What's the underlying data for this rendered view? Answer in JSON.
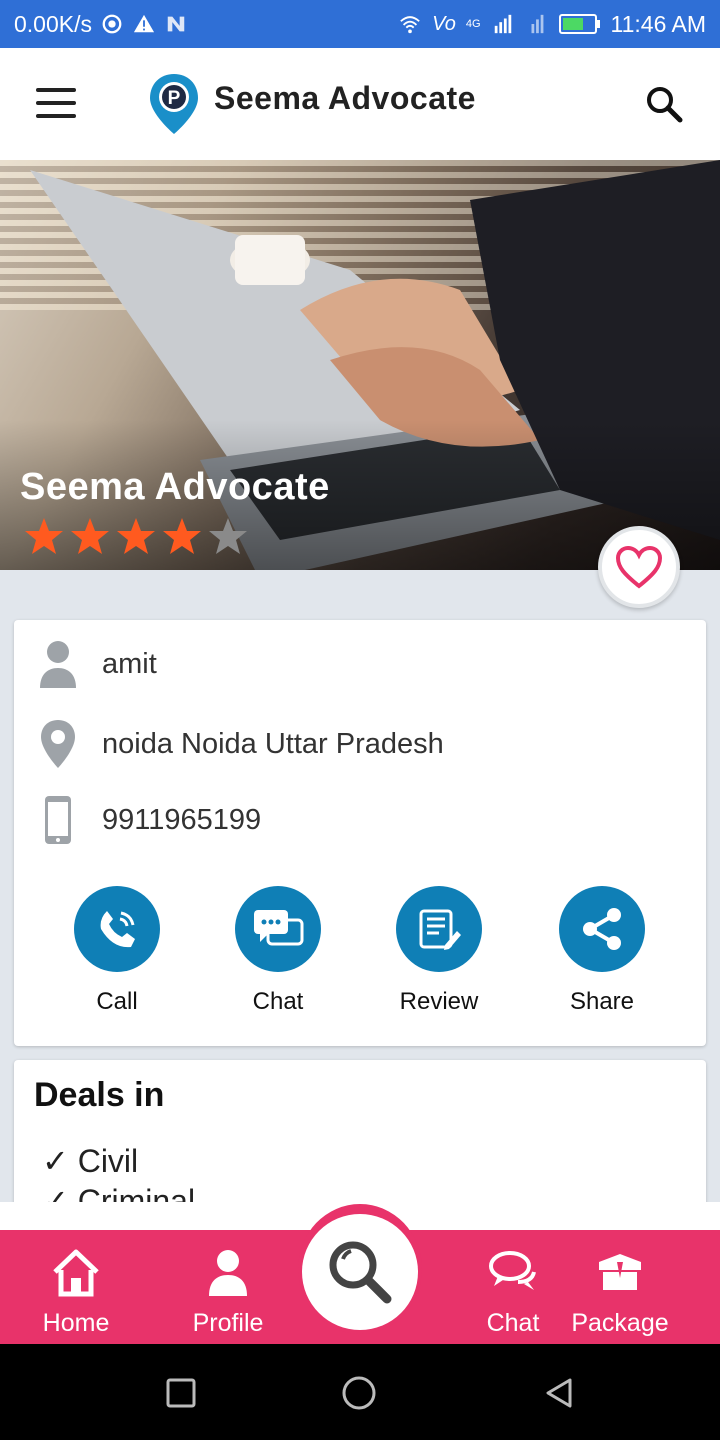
{
  "status_bar": {
    "speed": "0.00K/s",
    "time": "11:46 AM",
    "volte_label": "Vo",
    "network_label": "4G"
  },
  "app_bar": {
    "title": "Seema Advocate",
    "logo_letter": "P"
  },
  "hero": {
    "name": "Seema Advocate",
    "rating": 4,
    "rating_max": 5,
    "star_color": "#ff5a1f"
  },
  "details": {
    "contact_name": "amit",
    "address": "noida Noida Uttar Pradesh",
    "phone": "9911965199"
  },
  "actions": [
    {
      "label": "Call",
      "icon": "phone-icon"
    },
    {
      "label": "Chat",
      "icon": "chat-bubbles-icon"
    },
    {
      "label": "Review",
      "icon": "review-icon"
    },
    {
      "label": "Share",
      "icon": "share-icon"
    }
  ],
  "deals": {
    "heading": "Deals in",
    "items": [
      "✓ Civil",
      "✓  Criminal"
    ]
  },
  "bottom_nav": {
    "items": [
      {
        "label": "Home",
        "icon": "home-icon"
      },
      {
        "label": "Profile",
        "icon": "profile-icon"
      },
      {
        "label": "Chat",
        "icon": "chat-icon"
      },
      {
        "label": "Package",
        "icon": "package-icon"
      }
    ],
    "center_icon": "search-icon"
  },
  "colors": {
    "status_bar": "#2f6fd6",
    "accent": "#e8336a",
    "action_blue": "#0f7fb6",
    "logo_blue": "#1a8fc9"
  }
}
